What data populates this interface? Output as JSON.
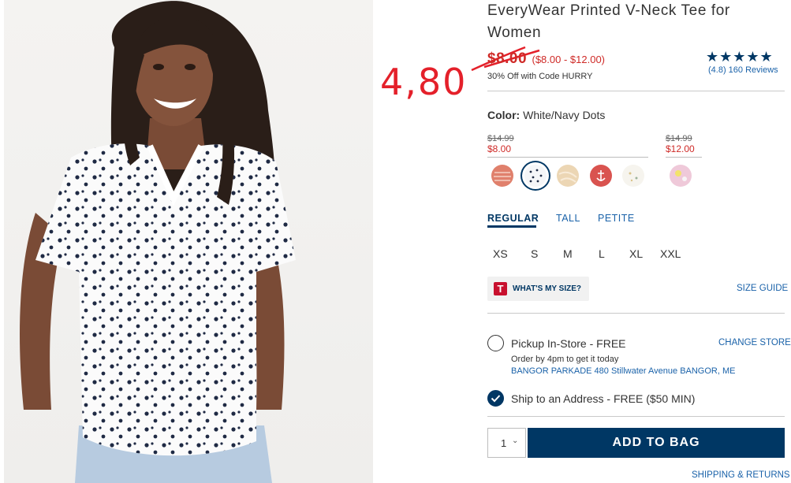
{
  "product": {
    "title": "EveryWear Printed V-Neck Tee for Women",
    "sale_price": "$8.00",
    "price_range": "($8.00 - $12.00)",
    "promo": "30% Off with Code HURRY",
    "rating_stars": "★★★★★",
    "rating": 4.8,
    "reviews": "(4.8) 160 Reviews"
  },
  "annotation": {
    "price": "4,80",
    "color": "#e4202a"
  },
  "color": {
    "label": "Color:",
    "value": "White/Navy Dots",
    "groups": [
      {
        "old_price": "$14.99",
        "new_price": "$8.00"
      },
      {
        "old_price": "$14.99",
        "new_price": "$12.00"
      }
    ],
    "swatches": [
      {
        "name": "coral-stripe",
        "color": "#e0806c"
      },
      {
        "name": "white-navy-dots",
        "color": "#f5f6f8",
        "selected": true
      },
      {
        "name": "beige-marble",
        "color": "#ecd6b4"
      },
      {
        "name": "red-anchor",
        "color": "#d9534f"
      },
      {
        "name": "white-floral",
        "color": "#f6f4ee"
      },
      {
        "name": "pink-yellow",
        "color": "#efc9d9"
      }
    ]
  },
  "fit": {
    "tabs": [
      "REGULAR",
      "TALL",
      "PETITE"
    ],
    "active": "REGULAR"
  },
  "sizes": [
    "XS",
    "S",
    "M",
    "L",
    "XL",
    "XXL"
  ],
  "fit_tool": {
    "logo": "T",
    "label": "WHAT'S MY SIZE?",
    "size_guide": "SIZE GUIDE"
  },
  "fulfillment": {
    "pickup_label": "Pickup In-Store - FREE",
    "order_by": "Order by 4pm to get it today",
    "store": "BANGOR PARKADE 480 Stillwater Avenue  BANGOR, ME",
    "change_store": "CHANGE STORE",
    "ship_label": "Ship to an Address - FREE ($50 MIN)",
    "ship_selected": true
  },
  "cart": {
    "quantity": "1",
    "add_label": "ADD TO BAG",
    "shipping_returns": "SHIPPING & RETURNS"
  },
  "colors": {
    "navy": "#003764",
    "sale_red": "#cf2a27",
    "link_blue": "#1a62a9"
  }
}
